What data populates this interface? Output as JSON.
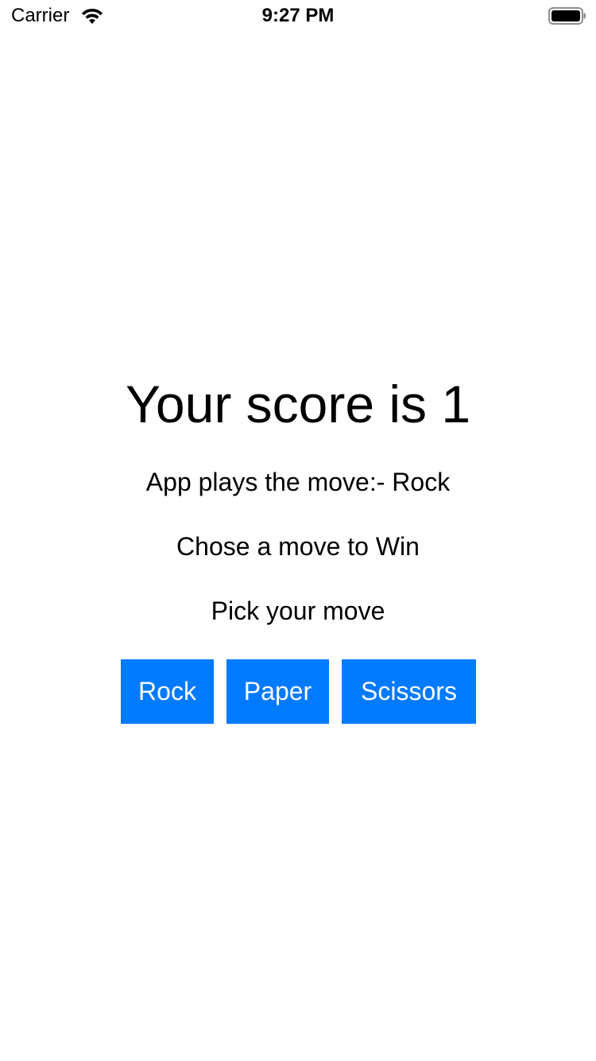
{
  "status_bar": {
    "carrier": "Carrier",
    "time": "9:27 PM",
    "wifi_icon": "wifi-icon",
    "battery_icon": "battery-icon"
  },
  "game": {
    "score_text": "Your score is 1",
    "app_move_text": "App plays the move:- Rock",
    "instruction_text": "Chose a move to Win",
    "prompt_text": "Pick your move"
  },
  "moves": {
    "rock_label": "Rock",
    "paper_label": "Paper",
    "scissors_label": "Scissors"
  },
  "colors": {
    "accent": "#007aff",
    "button_text": "#ffffff",
    "background": "#ffffff"
  }
}
